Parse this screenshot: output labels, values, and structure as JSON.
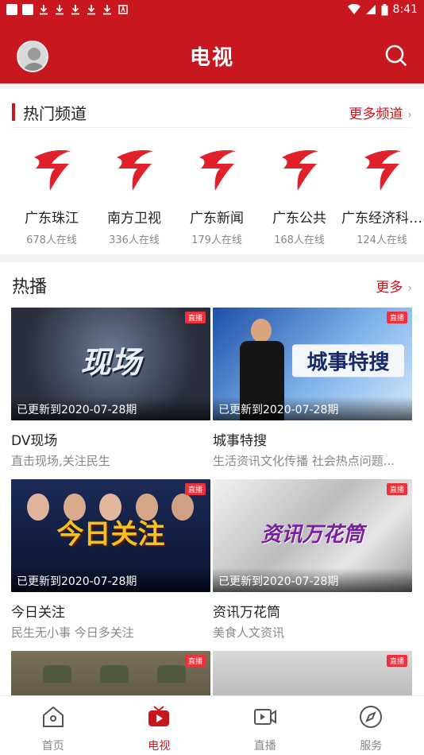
{
  "status_bar": {
    "time": "8:41"
  },
  "app_bar": {
    "title": "电视"
  },
  "hot_channels": {
    "title": "热门频道",
    "more_label": "更多频道",
    "items": [
      {
        "name": "广东珠江",
        "online": "678人在线"
      },
      {
        "name": "南方卫视",
        "online": "336人在线"
      },
      {
        "name": "广东新闻",
        "online": "179人在线"
      },
      {
        "name": "广东公共",
        "online": "168人在线"
      },
      {
        "name": "广东经济科…",
        "online": "124人在线"
      }
    ]
  },
  "hot_broadcast": {
    "title": "热播",
    "more_label": "更多",
    "items": [
      {
        "badge": "直播",
        "update": "已更新到2020-07-28期",
        "title": "DV现场",
        "subtitle": "直击现场,关注民生",
        "art_text": "现场"
      },
      {
        "badge": "直播",
        "update": "已更新到2020-07-28期",
        "title": "城事特搜",
        "subtitle": "生活资讯文化传播 社会热点问题...",
        "art_text": "城事特搜"
      },
      {
        "badge": "直播",
        "update": "已更新到2020-07-28期",
        "title": "今日关注",
        "subtitle": "民生无小事 今日多关注",
        "art_text": "今日关注"
      },
      {
        "badge": "直播",
        "update": "已更新到2020-07-28期",
        "title": "资讯万花筒",
        "subtitle": "美食人文资讯",
        "art_text": "资讯万花筒"
      },
      {
        "badge": "直播",
        "update": "",
        "title": "",
        "subtitle": "",
        "art_text": ""
      },
      {
        "badge": "直播",
        "update": "",
        "title": "",
        "subtitle": "",
        "art_text": ""
      }
    ]
  },
  "bottom_nav": {
    "items": [
      {
        "label": "首页",
        "icon": "home-icon"
      },
      {
        "label": "电视",
        "icon": "tv-icon"
      },
      {
        "label": "直播",
        "icon": "live-icon"
      },
      {
        "label": "服务",
        "icon": "compass-icon"
      }
    ],
    "active_index": 1
  },
  "colors": {
    "accent": "#c8171e",
    "text": "#222222",
    "muted": "#888888"
  }
}
